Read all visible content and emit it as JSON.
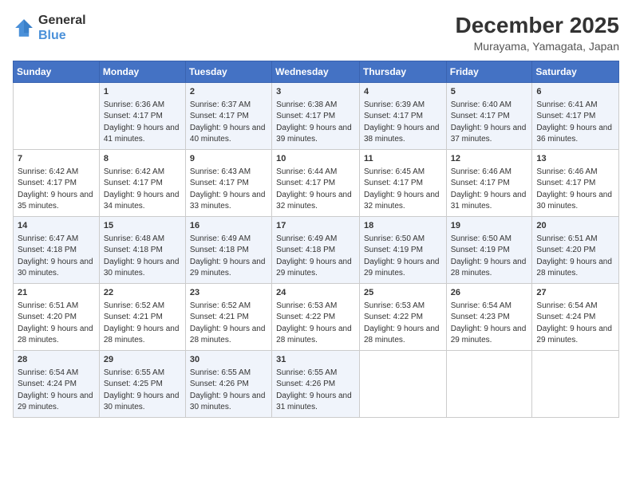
{
  "header": {
    "logo_general": "General",
    "logo_blue": "Blue",
    "month_title": "December 2025",
    "location": "Murayama, Yamagata, Japan"
  },
  "days_of_week": [
    "Sunday",
    "Monday",
    "Tuesday",
    "Wednesday",
    "Thursday",
    "Friday",
    "Saturday"
  ],
  "weeks": [
    [
      {
        "day": "",
        "sunrise": "",
        "sunset": "",
        "daylight": ""
      },
      {
        "day": "1",
        "sunrise": "Sunrise: 6:36 AM",
        "sunset": "Sunset: 4:17 PM",
        "daylight": "Daylight: 9 hours and 41 minutes."
      },
      {
        "day": "2",
        "sunrise": "Sunrise: 6:37 AM",
        "sunset": "Sunset: 4:17 PM",
        "daylight": "Daylight: 9 hours and 40 minutes."
      },
      {
        "day": "3",
        "sunrise": "Sunrise: 6:38 AM",
        "sunset": "Sunset: 4:17 PM",
        "daylight": "Daylight: 9 hours and 39 minutes."
      },
      {
        "day": "4",
        "sunrise": "Sunrise: 6:39 AM",
        "sunset": "Sunset: 4:17 PM",
        "daylight": "Daylight: 9 hours and 38 minutes."
      },
      {
        "day": "5",
        "sunrise": "Sunrise: 6:40 AM",
        "sunset": "Sunset: 4:17 PM",
        "daylight": "Daylight: 9 hours and 37 minutes."
      },
      {
        "day": "6",
        "sunrise": "Sunrise: 6:41 AM",
        "sunset": "Sunset: 4:17 PM",
        "daylight": "Daylight: 9 hours and 36 minutes."
      }
    ],
    [
      {
        "day": "7",
        "sunrise": "Sunrise: 6:42 AM",
        "sunset": "Sunset: 4:17 PM",
        "daylight": "Daylight: 9 hours and 35 minutes."
      },
      {
        "day": "8",
        "sunrise": "Sunrise: 6:42 AM",
        "sunset": "Sunset: 4:17 PM",
        "daylight": "Daylight: 9 hours and 34 minutes."
      },
      {
        "day": "9",
        "sunrise": "Sunrise: 6:43 AM",
        "sunset": "Sunset: 4:17 PM",
        "daylight": "Daylight: 9 hours and 33 minutes."
      },
      {
        "day": "10",
        "sunrise": "Sunrise: 6:44 AM",
        "sunset": "Sunset: 4:17 PM",
        "daylight": "Daylight: 9 hours and 32 minutes."
      },
      {
        "day": "11",
        "sunrise": "Sunrise: 6:45 AM",
        "sunset": "Sunset: 4:17 PM",
        "daylight": "Daylight: 9 hours and 32 minutes."
      },
      {
        "day": "12",
        "sunrise": "Sunrise: 6:46 AM",
        "sunset": "Sunset: 4:17 PM",
        "daylight": "Daylight: 9 hours and 31 minutes."
      },
      {
        "day": "13",
        "sunrise": "Sunrise: 6:46 AM",
        "sunset": "Sunset: 4:17 PM",
        "daylight": "Daylight: 9 hours and 30 minutes."
      }
    ],
    [
      {
        "day": "14",
        "sunrise": "Sunrise: 6:47 AM",
        "sunset": "Sunset: 4:18 PM",
        "daylight": "Daylight: 9 hours and 30 minutes."
      },
      {
        "day": "15",
        "sunrise": "Sunrise: 6:48 AM",
        "sunset": "Sunset: 4:18 PM",
        "daylight": "Daylight: 9 hours and 30 minutes."
      },
      {
        "day": "16",
        "sunrise": "Sunrise: 6:49 AM",
        "sunset": "Sunset: 4:18 PM",
        "daylight": "Daylight: 9 hours and 29 minutes."
      },
      {
        "day": "17",
        "sunrise": "Sunrise: 6:49 AM",
        "sunset": "Sunset: 4:18 PM",
        "daylight": "Daylight: 9 hours and 29 minutes."
      },
      {
        "day": "18",
        "sunrise": "Sunrise: 6:50 AM",
        "sunset": "Sunset: 4:19 PM",
        "daylight": "Daylight: 9 hours and 29 minutes."
      },
      {
        "day": "19",
        "sunrise": "Sunrise: 6:50 AM",
        "sunset": "Sunset: 4:19 PM",
        "daylight": "Daylight: 9 hours and 28 minutes."
      },
      {
        "day": "20",
        "sunrise": "Sunrise: 6:51 AM",
        "sunset": "Sunset: 4:20 PM",
        "daylight": "Daylight: 9 hours and 28 minutes."
      }
    ],
    [
      {
        "day": "21",
        "sunrise": "Sunrise: 6:51 AM",
        "sunset": "Sunset: 4:20 PM",
        "daylight": "Daylight: 9 hours and 28 minutes."
      },
      {
        "day": "22",
        "sunrise": "Sunrise: 6:52 AM",
        "sunset": "Sunset: 4:21 PM",
        "daylight": "Daylight: 9 hours and 28 minutes."
      },
      {
        "day": "23",
        "sunrise": "Sunrise: 6:52 AM",
        "sunset": "Sunset: 4:21 PM",
        "daylight": "Daylight: 9 hours and 28 minutes."
      },
      {
        "day": "24",
        "sunrise": "Sunrise: 6:53 AM",
        "sunset": "Sunset: 4:22 PM",
        "daylight": "Daylight: 9 hours and 28 minutes."
      },
      {
        "day": "25",
        "sunrise": "Sunrise: 6:53 AM",
        "sunset": "Sunset: 4:22 PM",
        "daylight": "Daylight: 9 hours and 28 minutes."
      },
      {
        "day": "26",
        "sunrise": "Sunrise: 6:54 AM",
        "sunset": "Sunset: 4:23 PM",
        "daylight": "Daylight: 9 hours and 29 minutes."
      },
      {
        "day": "27",
        "sunrise": "Sunrise: 6:54 AM",
        "sunset": "Sunset: 4:24 PM",
        "daylight": "Daylight: 9 hours and 29 minutes."
      }
    ],
    [
      {
        "day": "28",
        "sunrise": "Sunrise: 6:54 AM",
        "sunset": "Sunset: 4:24 PM",
        "daylight": "Daylight: 9 hours and 29 minutes."
      },
      {
        "day": "29",
        "sunrise": "Sunrise: 6:55 AM",
        "sunset": "Sunset: 4:25 PM",
        "daylight": "Daylight: 9 hours and 30 minutes."
      },
      {
        "day": "30",
        "sunrise": "Sunrise: 6:55 AM",
        "sunset": "Sunset: 4:26 PM",
        "daylight": "Daylight: 9 hours and 30 minutes."
      },
      {
        "day": "31",
        "sunrise": "Sunrise: 6:55 AM",
        "sunset": "Sunset: 4:26 PM",
        "daylight": "Daylight: 9 hours and 31 minutes."
      },
      {
        "day": "",
        "sunrise": "",
        "sunset": "",
        "daylight": ""
      },
      {
        "day": "",
        "sunrise": "",
        "sunset": "",
        "daylight": ""
      },
      {
        "day": "",
        "sunrise": "",
        "sunset": "",
        "daylight": ""
      }
    ]
  ]
}
